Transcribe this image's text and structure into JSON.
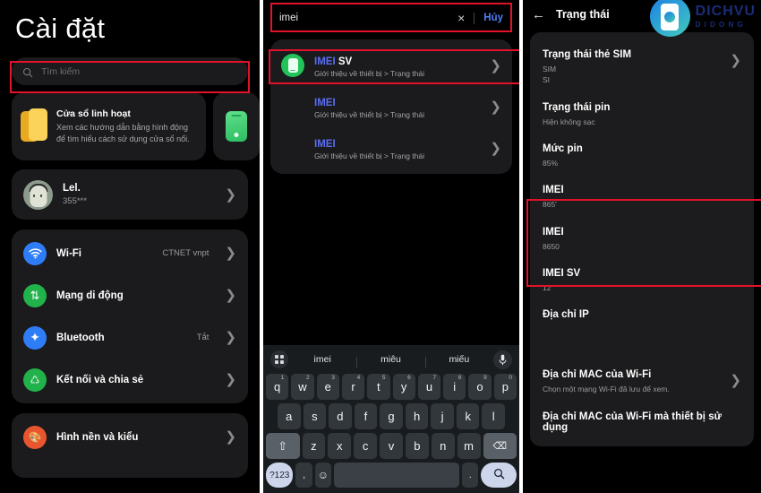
{
  "panel1": {
    "title": "Cài đặt",
    "search": {
      "placeholder": "Tìm kiếm",
      "icon": "search-icon"
    },
    "feature_card": {
      "title": "Cửa sổ linh hoạt",
      "body": "Xem các hướng dẫn bằng hình động để tìm hiểu cách sử dụng cửa sổ nổi."
    },
    "account": {
      "name": "Lel.",
      "sub": "355***"
    },
    "rows": [
      {
        "label": "Wi-Fi",
        "value": "CTNET vnpt",
        "icon": "wifi-icon",
        "color": "#2f7df6"
      },
      {
        "label": "Mạng di động",
        "value": "",
        "icon": "mobile-network-icon",
        "color": "#22b24c"
      },
      {
        "label": "Bluetooth",
        "value": "Tắt",
        "icon": "bluetooth-icon",
        "color": "#2f7df6"
      },
      {
        "label": "Kết nối và chia sẻ",
        "value": "",
        "icon": "share-icon",
        "color": "#22b24c"
      }
    ],
    "rows2": [
      {
        "label": "Hình nền và kiểu",
        "value": "",
        "icon": "wallpaper-icon",
        "color": "#e8552f"
      }
    ]
  },
  "panel2": {
    "search": {
      "value": "imei",
      "clear": "×",
      "cancel": "Hủy"
    },
    "results": [
      {
        "title_bold": "IMEI",
        "title_rest": " SV",
        "sub": "Giới thiệu về thiết bị > Trạng thái",
        "has_icon": true
      },
      {
        "title_bold": "IMEI",
        "title_rest": "",
        "sub": "Giới thiệu về thiết bị > Trạng thái",
        "has_icon": false
      },
      {
        "title_bold": "IMEI",
        "title_rest": "",
        "sub": "Giới thiệu về thiết bị > Trạng thái",
        "has_icon": false
      }
    ],
    "keyboard": {
      "suggestions": [
        "imei",
        "miêu",
        "miếu"
      ],
      "row1": [
        {
          "k": "q",
          "n": "1"
        },
        {
          "k": "w",
          "n": "2"
        },
        {
          "k": "e",
          "n": "3"
        },
        {
          "k": "r",
          "n": "4"
        },
        {
          "k": "t",
          "n": "5"
        },
        {
          "k": "y",
          "n": "6"
        },
        {
          "k": "u",
          "n": "7"
        },
        {
          "k": "i",
          "n": "8"
        },
        {
          "k": "o",
          "n": "9"
        },
        {
          "k": "p",
          "n": "0"
        }
      ],
      "row2": [
        "a",
        "s",
        "d",
        "f",
        "g",
        "h",
        "j",
        "k",
        "l"
      ],
      "row3": [
        "z",
        "x",
        "c",
        "v",
        "b",
        "n",
        "m"
      ],
      "shift": "⇧",
      "backspace": "⌫",
      "numeric": "?123",
      "comma": ",",
      "emoji": "☺",
      "space": "",
      "period": ".",
      "search_key": "search-icon",
      "mic": "mic-icon",
      "grid": "keyboard-switch-icon"
    }
  },
  "panel3": {
    "header": {
      "back": "←",
      "title": "Trạng thái"
    },
    "logo": {
      "line1": "DICHVU",
      "line2": "DIDONG"
    },
    "items": [
      {
        "label": "Trạng thái thẻ SIM",
        "sub": "SIM\nSI",
        "chevron": true
      },
      {
        "label": "Trạng thái pin",
        "sub": "Hiện không sạc",
        "chevron": false
      },
      {
        "label": "Mức pin",
        "sub": "85%",
        "chevron": false
      },
      {
        "label": "IMEI",
        "sub": "865'",
        "chevron": false
      },
      {
        "label": "IMEI",
        "sub": "8650",
        "chevron": false
      },
      {
        "label": "IMEI SV",
        "sub": "12",
        "chevron": false
      },
      {
        "label": "Địa chỉ IP",
        "sub": "",
        "chevron": false
      },
      {
        "label": "Địa chỉ MAC của Wi-Fi",
        "sub": "Chọn một mạng Wi-Fi đã lưu để xem.",
        "chevron": true
      },
      {
        "label": "Địa chỉ MAC của Wi-Fi mà thiết bị sử dụng",
        "sub": "",
        "chevron": false
      }
    ]
  },
  "annotations": {
    "highlight_color": "#e2122a"
  }
}
